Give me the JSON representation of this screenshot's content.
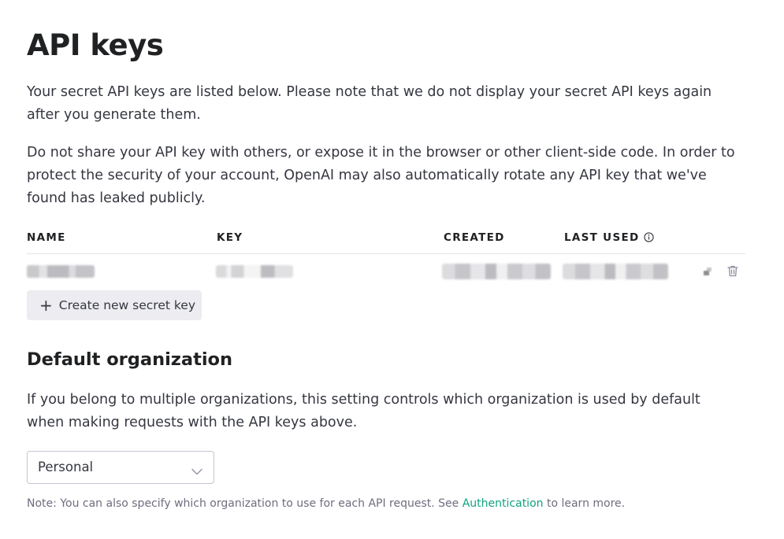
{
  "header": {
    "title": "API keys"
  },
  "intro": {
    "paragraph_1": "Your secret API keys are listed below. Please note that we do not display your secret API keys again after you generate them.",
    "paragraph_2": "Do not share your API key with others, or expose it in the browser or other client-side code. In order to protect the security of your account, OpenAI may also automatically rotate any API key that we've found has leaked publicly."
  },
  "keys_table": {
    "columns": {
      "name": "NAME",
      "key": "KEY",
      "created": "CREATED",
      "last_used": "LAST USED"
    },
    "row_icons": [
      "edit-icon",
      "trash-icon"
    ]
  },
  "actions": {
    "create_label": "Create new secret key",
    "create_icon": "plus-icon"
  },
  "default_org": {
    "heading": "Default organization",
    "description": "If you belong to multiple organizations, this setting controls which organization is used by default when making requests with the API keys above.",
    "selected": "Personal",
    "note_prefix": "Note: You can also specify which organization to use for each API request. See",
    "note_link": "Authentication",
    "note_suffix": "to learn more."
  },
  "colors": {
    "text": "#353740",
    "heading": "#202123",
    "muted": "#6e6e80",
    "link": "#10a37f",
    "button_bg": "#ececf1",
    "border": "#c5c5d2"
  }
}
